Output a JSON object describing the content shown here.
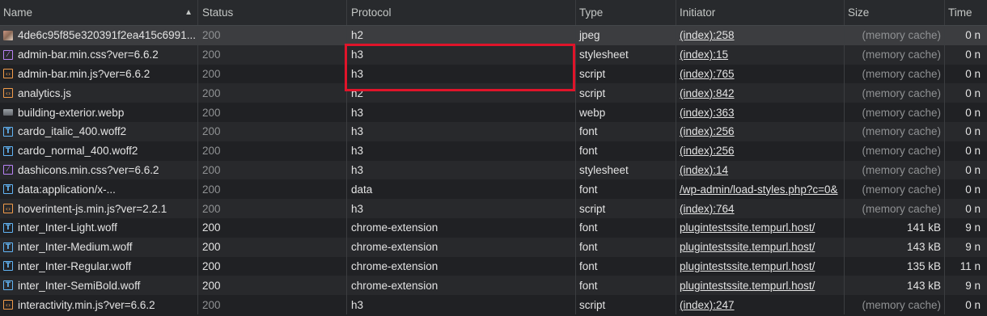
{
  "columns": {
    "name": "Name",
    "status": "Status",
    "protocol": "Protocol",
    "type": "Type",
    "initiator": "Initiator",
    "size": "Size",
    "time": "Time"
  },
  "rows": [
    {
      "name": "4de6c95f85e320391f2ea415c6991...",
      "icon": "image-icon",
      "status": "200",
      "protocol": "h2",
      "type": "jpeg",
      "initiator": "(index):258",
      "size": "(memory cache)",
      "time": "0 n",
      "cached": true
    },
    {
      "name": "admin-bar.min.css?ver=6.6.2",
      "icon": "stylesheet-icon",
      "status": "200",
      "protocol": "h3",
      "type": "stylesheet",
      "initiator": "(index):15",
      "size": "(memory cache)",
      "time": "0 n",
      "cached": true
    },
    {
      "name": "admin-bar.min.js?ver=6.6.2",
      "icon": "script-icon",
      "status": "200",
      "protocol": "h3",
      "type": "script",
      "initiator": "(index):765",
      "size": "(memory cache)",
      "time": "0 n",
      "cached": true
    },
    {
      "name": "analytics.js",
      "icon": "script-icon",
      "status": "200",
      "protocol": "h2",
      "type": "script",
      "initiator": "(index):842",
      "size": "(memory cache)",
      "time": "0 n",
      "cached": true
    },
    {
      "name": "building-exterior.webp",
      "icon": "webp-image-icon",
      "status": "200",
      "protocol": "h3",
      "type": "webp",
      "initiator": "(index):363",
      "size": "(memory cache)",
      "time": "0 n",
      "cached": true
    },
    {
      "name": "cardo_italic_400.woff2",
      "icon": "font-icon",
      "status": "200",
      "protocol": "h3",
      "type": "font",
      "initiator": "(index):256",
      "size": "(memory cache)",
      "time": "0 n",
      "cached": true
    },
    {
      "name": "cardo_normal_400.woff2",
      "icon": "font-icon",
      "status": "200",
      "protocol": "h3",
      "type": "font",
      "initiator": "(index):256",
      "size": "(memory cache)",
      "time": "0 n",
      "cached": true
    },
    {
      "name": "dashicons.min.css?ver=6.6.2",
      "icon": "stylesheet-icon",
      "status": "200",
      "protocol": "h3",
      "type": "stylesheet",
      "initiator": "(index):14",
      "size": "(memory cache)",
      "time": "0 n",
      "cached": true
    },
    {
      "name": "data:application/x-...",
      "icon": "font-icon",
      "status": "200",
      "protocol": "data",
      "type": "font",
      "initiator": "/wp-admin/load-styles.php?c=0&",
      "size": "(memory cache)",
      "time": "0 n",
      "cached": true
    },
    {
      "name": "hoverintent-js.min.js?ver=2.2.1",
      "icon": "script-icon",
      "status": "200",
      "protocol": "h3",
      "type": "script",
      "initiator": "(index):764",
      "size": "(memory cache)",
      "time": "0 n",
      "cached": true
    },
    {
      "name": "inter_Inter-Light.woff",
      "icon": "font-icon",
      "status": "200",
      "protocol": "chrome-extension",
      "type": "font",
      "initiator": "plugintestssite.tempurl.host/",
      "size": "141 kB",
      "time": "9 n",
      "cached": false
    },
    {
      "name": "inter_Inter-Medium.woff",
      "icon": "font-icon",
      "status": "200",
      "protocol": "chrome-extension",
      "type": "font",
      "initiator": "plugintestssite.tempurl.host/",
      "size": "143 kB",
      "time": "9 n",
      "cached": false
    },
    {
      "name": "inter_Inter-Regular.woff",
      "icon": "font-icon",
      "status": "200",
      "protocol": "chrome-extension",
      "type": "font",
      "initiator": "plugintestssite.tempurl.host/",
      "size": "135 kB",
      "time": "11 n",
      "cached": false
    },
    {
      "name": "inter_Inter-SemiBold.woff",
      "icon": "font-icon",
      "status": "200",
      "protocol": "chrome-extension",
      "type": "font",
      "initiator": "plugintestssite.tempurl.host/",
      "size": "143 kB",
      "time": "9 n",
      "cached": false
    },
    {
      "name": "interactivity.min.js?ver=6.6.2",
      "icon": "script-icon",
      "status": "200",
      "protocol": "h3",
      "type": "script",
      "initiator": "(index):247",
      "size": "(memory cache)",
      "time": "0 n",
      "cached": true
    }
  ],
  "colors": {
    "background": "#202124",
    "highlight_box": "#e0142a",
    "stylesheet_icon": "#b983f7",
    "script_icon": "#f29c4a",
    "font_icon": "#62b5f6"
  }
}
